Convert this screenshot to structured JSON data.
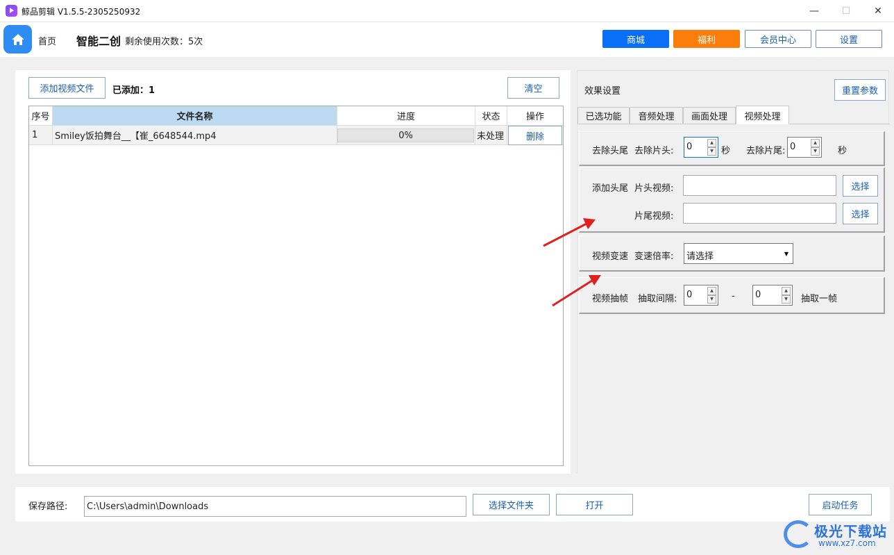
{
  "window": {
    "title": "鲸品剪辑 V1.5.5-2305250932",
    "min": "—",
    "max": "☐",
    "close": "✕"
  },
  "header": {
    "home_label": "首页",
    "brand": "智能二创",
    "remaining": "剩余使用次数：5次",
    "buttons": {
      "shop": "商城",
      "welfare": "福利",
      "member": "会员中心",
      "settings": "设置"
    }
  },
  "file_panel": {
    "add_button": "添加视频文件",
    "added_label": "已添加：",
    "added_count": "1",
    "clear_button": "清空",
    "columns": {
      "index": "序号",
      "name": "文件名称",
      "progress": "进度",
      "status": "状态",
      "action": "操作"
    },
    "rows": [
      {
        "index": "1",
        "name": "Smiley饭拍舞台__【崔_6648544.mp4",
        "progress": "0%",
        "progress_value": 0,
        "status": "未处理",
        "action": "删除"
      }
    ]
  },
  "effects": {
    "title": "效果设置",
    "reset_button": "重置参数",
    "tabs": [
      "已选功能",
      "音频处理",
      "画面处理",
      "视频处理"
    ],
    "active_tab": "视频处理",
    "trim": {
      "group": "去除头尾",
      "head_label": "去除片头:",
      "head_value": "0",
      "head_unit": "秒",
      "tail_label": "去除片尾:",
      "tail_value": "0",
      "tail_unit": "秒"
    },
    "add_ends": {
      "group": "添加头尾",
      "head_label": "片头视频:",
      "tail_label": "片尾视频:",
      "choose": "选择"
    },
    "speed": {
      "group": "视频变速",
      "label": "变速倍率:",
      "value": "请选择"
    },
    "frames": {
      "group": "视频抽帧",
      "label": "抽取间隔:",
      "from": "0",
      "dash": "-",
      "to": "0",
      "suffix": "抽取一帧"
    }
  },
  "bottom": {
    "save_label": "保存路径:",
    "path": "C:\\Users\\admin\\Downloads",
    "choose_folder": "选择文件夹",
    "open": "打开",
    "start": "启动任务"
  },
  "watermark": {
    "text": "极光下载站",
    "url": "www.xz7.com"
  },
  "colors": {
    "accent": "#0b6ff5",
    "orange": "#fb7e0c",
    "header_sel": "#bddaf3",
    "arrow": "#e02020"
  }
}
